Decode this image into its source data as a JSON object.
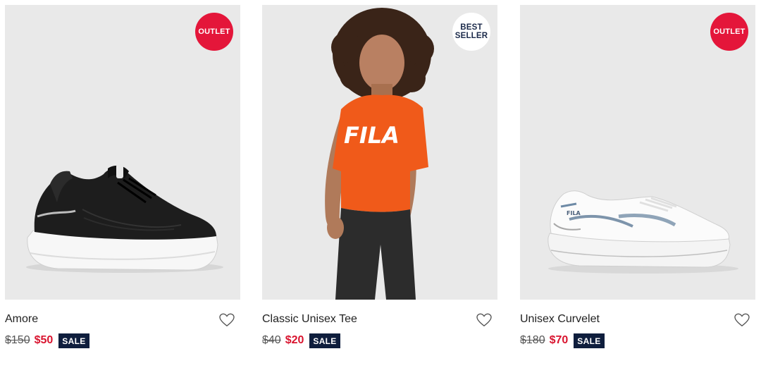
{
  "colors": {
    "outlet_badge": "#e4163a",
    "sale_price": "#d9142f",
    "sale_tag": "#0f1e3d",
    "image_bg": "#e9e9e9"
  },
  "products": [
    {
      "name": "Amore",
      "badge": "OUTLET",
      "old_price": "$150",
      "new_price": "$50",
      "sale_label": "SALE",
      "image": "black-white-chunky-sneaker",
      "wishlist_icon": "heart-outline-icon"
    },
    {
      "name": "Classic Unisex Tee",
      "badge_line1": "BEST",
      "badge_line2": "SELLER",
      "old_price": "$40",
      "new_price": "$20",
      "sale_label": "SALE",
      "image": "model-orange-fila-tee",
      "wishlist_icon": "heart-outline-icon"
    },
    {
      "name": "Unisex Curvelet",
      "badge": "OUTLET",
      "old_price": "$180",
      "new_price": "$70",
      "sale_label": "SALE",
      "image": "white-grey-running-sneaker",
      "wishlist_icon": "heart-outline-icon"
    }
  ]
}
